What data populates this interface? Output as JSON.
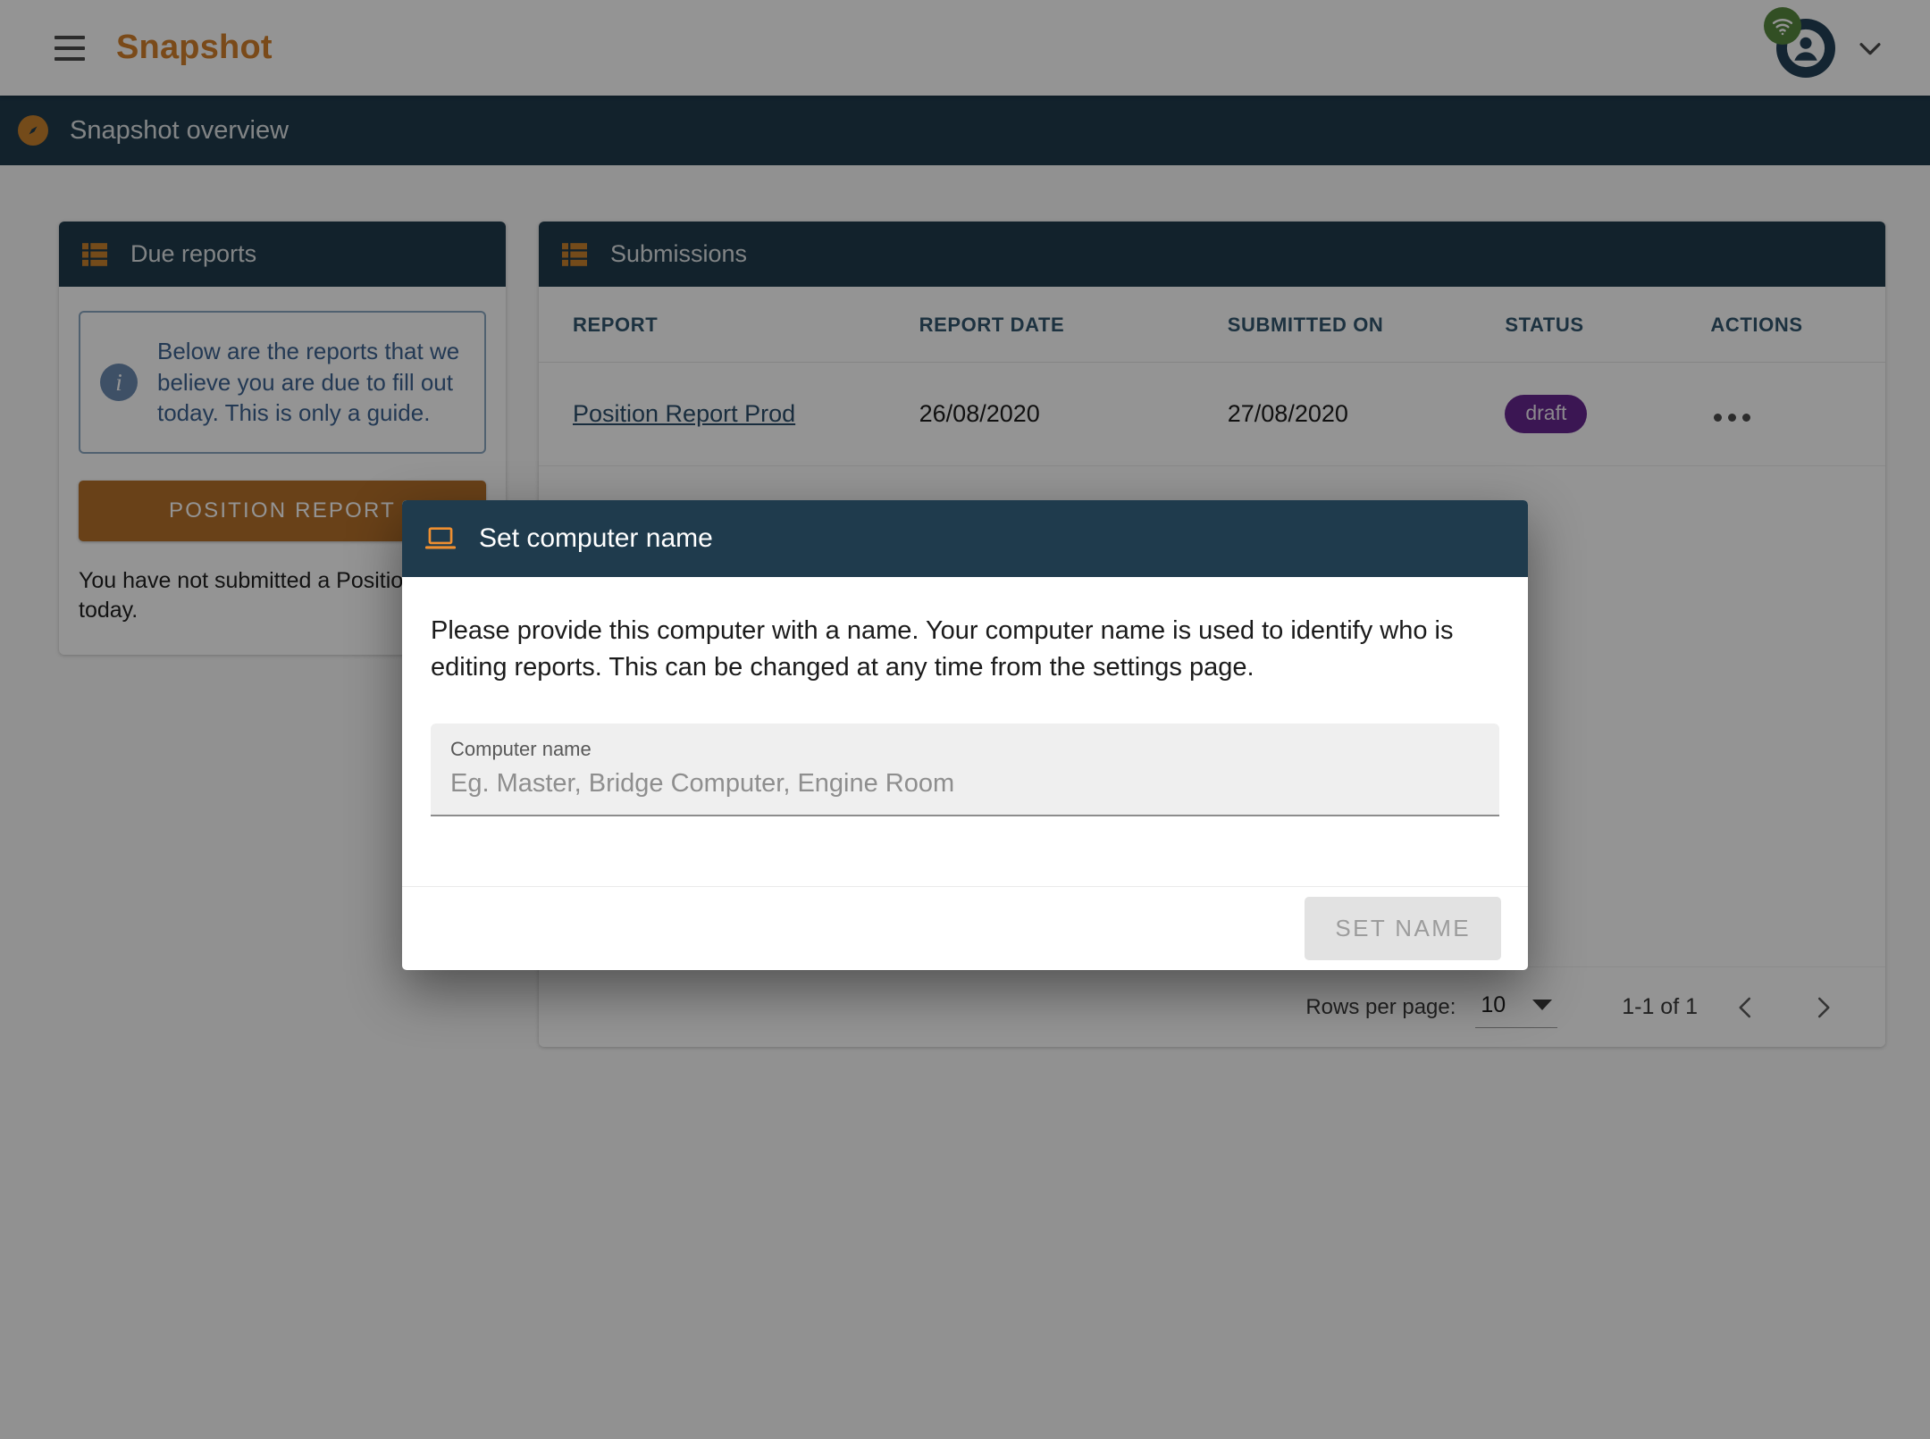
{
  "appbar": {
    "menu_icon": "hamburger-menu-icon",
    "brand": "Snapshot",
    "account_icon": "account-circle-icon",
    "connection_icon": "wifi-online-icon",
    "expand_icon": "chevron-down-icon"
  },
  "subbar": {
    "icon": "explore-compass-icon",
    "title": "Snapshot overview"
  },
  "due_reports": {
    "icon": "list-table-icon",
    "title": "Due reports",
    "info_icon": "info-icon",
    "info_text": "Below are the reports that we believe you are due to fill out today. This is only a guide.",
    "cta_label": "POSITION REPORT",
    "note": "You have not submitted a Position report today."
  },
  "submissions": {
    "icon": "list-table-icon",
    "title": "Submissions",
    "columns": [
      "REPORT",
      "REPORT DATE",
      "SUBMITTED ON",
      "STATUS",
      "ACTIONS"
    ],
    "rows": [
      {
        "report": "Position Report Prod",
        "report_date": "26/08/2020",
        "submitted_on": "27/08/2020",
        "status": "draft",
        "status_color": "#66268f",
        "actions_icon": "more-horizontal-icon"
      }
    ],
    "footer": {
      "rows_per_page_label": "Rows per page:",
      "rows_per_page_value": "10",
      "dropdown_icon": "caret-down-icon",
      "range": "1-1 of 1",
      "prev_icon": "chevron-left-icon",
      "next_icon": "chevron-right-icon"
    }
  },
  "modal": {
    "icon": "laptop-icon",
    "title": "Set computer name",
    "body_text": "Please provide this computer with a name. Your computer name is used to identify who is editing reports. This can be changed at any time from the settings page.",
    "field": {
      "label": "Computer name",
      "placeholder": "Eg. Master, Bridge Computer, Engine Room",
      "value": ""
    },
    "confirm_label": "SET NAME"
  },
  "colors": {
    "brand_orange": "#d2802b",
    "header_navy": "#1f3b4d",
    "cta_orange": "#b5702a",
    "status_purple": "#66268f",
    "online_green": "#57883f"
  }
}
